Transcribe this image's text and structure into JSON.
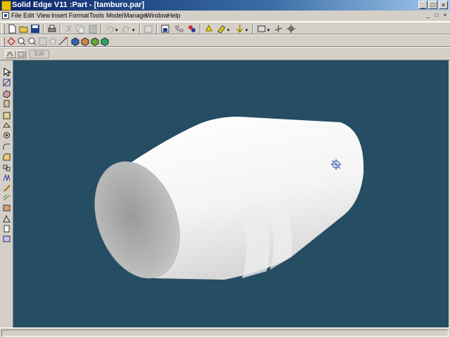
{
  "window": {
    "title": "Solid Edge V11 :Part - [tamburo.par]",
    "caption_buttons": [
      "_",
      "□",
      "×"
    ]
  },
  "menubar": {
    "items": [
      "File",
      "Edit",
      "View",
      "Insert",
      "Format",
      "Tools",
      "Model",
      "Manage",
      "Window",
      "Help"
    ],
    "mdi_buttons": [
      "_",
      "□",
      "×"
    ]
  },
  "ribbon": {
    "edit_label": "Edit"
  },
  "icons": {
    "toolbar1": [
      "new-document-icon",
      "open-folder-icon",
      "save-icon",
      "print-icon",
      "cut-icon",
      "copy-icon",
      "paste-icon",
      "undo-icon",
      "redo-icon",
      "properties-icon",
      "save-as-image-icon",
      "pathfinder-icon",
      "hierarchy-icon",
      "yellow-light-icon",
      "paint-icon",
      "arrow-down-icon",
      "view-icon",
      "coordinate-axes-icon",
      "select-tool-icon"
    ],
    "toolbar2": [
      "select-icon",
      "zoom-area-icon",
      "zoom-icon",
      "fit-icon",
      "pan-icon",
      "rotate-icon",
      "shaded-icon",
      "wireframe-icon",
      "visible-edges-icon",
      "hidden-edges-icon"
    ],
    "left": [
      "select-arrow-icon",
      "sketch-icon",
      "protrusion-icon",
      "revolved-protrusion-icon",
      "cutout-icon",
      "revolved-cutout-icon",
      "hole-icon",
      "round-icon",
      "chamfer-icon",
      "thin-wall-icon",
      "rib-icon",
      "pattern-icon",
      "mirror-icon",
      "draft-icon",
      "web-network-icon",
      "lip-icon",
      "vent-icon",
      "mounting-boss-icon"
    ]
  },
  "colors": {
    "titlebar": "#0a246a",
    "viewport_background": "#254d63",
    "model_surface": "#ffffff"
  }
}
